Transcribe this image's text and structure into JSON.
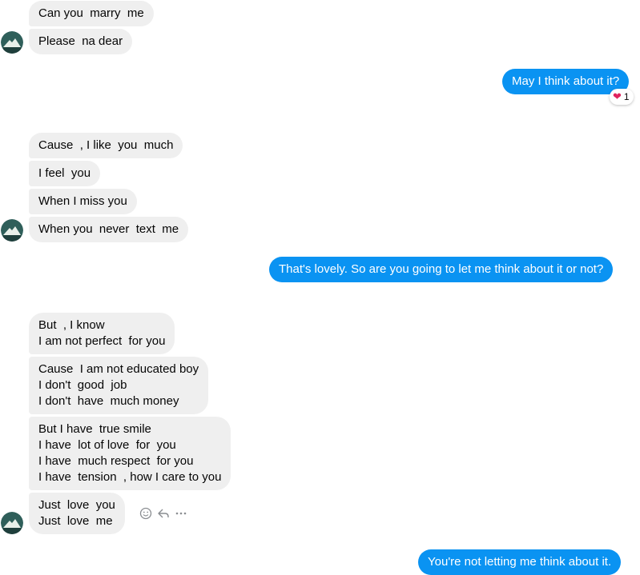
{
  "messages": {
    "m1": "Can you  marry  me",
    "m2": "Please  na dear",
    "m3": "May I think about it?",
    "m3_reaction": {
      "emoji": "❤",
      "count": "1"
    },
    "m4": "Cause  , I like  you  much",
    "m5": "I feel  you",
    "m6": "When I miss you",
    "m7": "When you  never  text  me",
    "m8": "That's lovely. So are you going to let me think about it or not?",
    "m9": "But  , I know\nI am not perfect  for you",
    "m10": "Cause  I am not educated boy\nI don't  good  job\nI don't  have  much money",
    "m11": "But I have  true smile\nI have  lot of love  for  you\nI have  much respect  for you\nI have  tension  , how I care to you",
    "m12": "Just  love  you\nJust  love  me",
    "m13": "You're not letting me think about it."
  },
  "colors": {
    "incoming_bg": "#efefef",
    "outgoing_bg": "#0a93f2",
    "text_dark": "#050505",
    "icon_gray": "#8a8d91"
  },
  "icons": [
    "avatar",
    "heart-icon",
    "react-icon",
    "reply-icon",
    "more-icon"
  ]
}
